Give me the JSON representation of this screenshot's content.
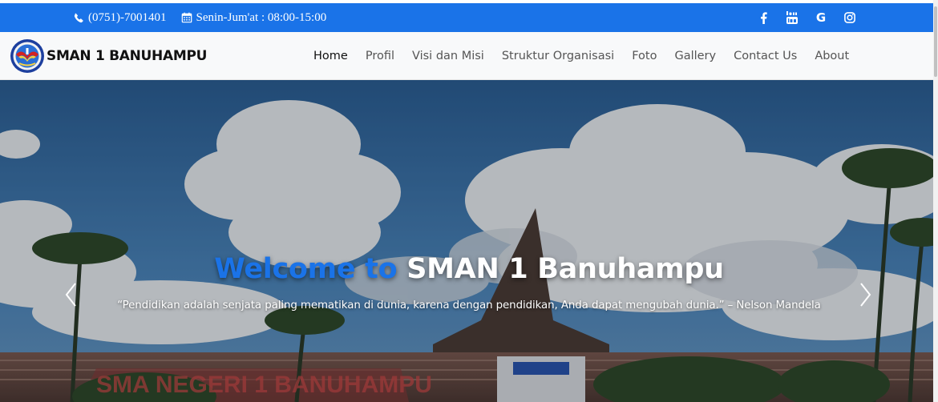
{
  "topbar": {
    "phone_icon": "phone-icon",
    "phone": "(0751)-7001401",
    "hours_icon": "calendar-icon",
    "hours": "Senin-Jum'at : 08:00-15:00",
    "social": [
      "facebook-icon",
      "youtube-icon",
      "google-icon",
      "instagram-icon"
    ],
    "google_glyph": "G",
    "bg_color": "#1a73e8"
  },
  "navbar": {
    "brand": "SMAN 1 BANUHAMPU",
    "items": [
      {
        "label": "Home",
        "active": true
      },
      {
        "label": "Profil"
      },
      {
        "label": "Visi dan Misi"
      },
      {
        "label": "Struktur Organisasi"
      },
      {
        "label": "Foto"
      },
      {
        "label": "Gallery"
      },
      {
        "label": "Contact Us"
      },
      {
        "label": "About"
      }
    ]
  },
  "hero": {
    "title_accent": "Welcome to",
    "title_main": "SMAN 1 Banuhampu",
    "quote": "“Pendidikan adalah senjata paling mematikan di dunia, karena dengan pendidikan, Anda dapat mengubah dunia.” – Nelson Mandela",
    "building_sign": "SMA NEGERI 1 BANUHAMPU",
    "accent_color": "#1a73e8",
    "prev_icon": "chevron-left-icon",
    "next_icon": "chevron-right-icon"
  }
}
